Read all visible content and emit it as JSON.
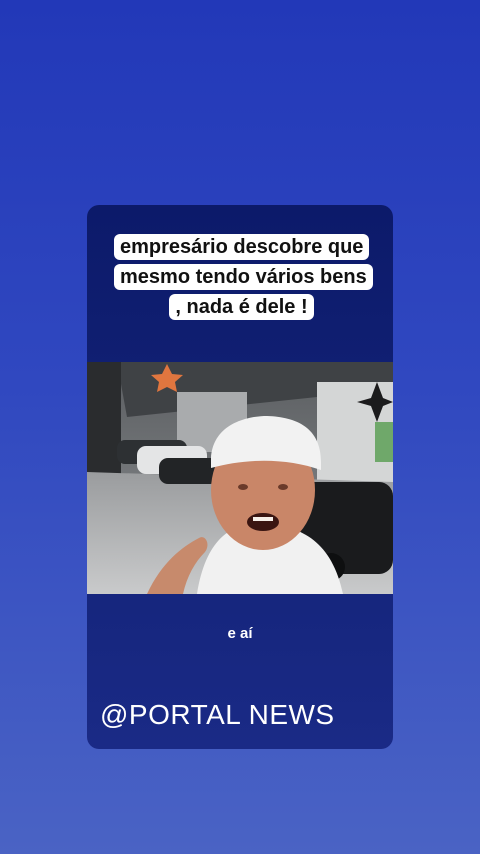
{
  "post": {
    "headline": "empresário  descobre que mesmo tendo vários bens , nada é dele !",
    "caption": "e aí",
    "watermark": "@PORTAL NEWS"
  },
  "colors": {
    "background_top": "#2238b8",
    "background_bottom": "#4a63c4",
    "card": "#0c1a6a",
    "headline_bg": "#ffffff"
  }
}
